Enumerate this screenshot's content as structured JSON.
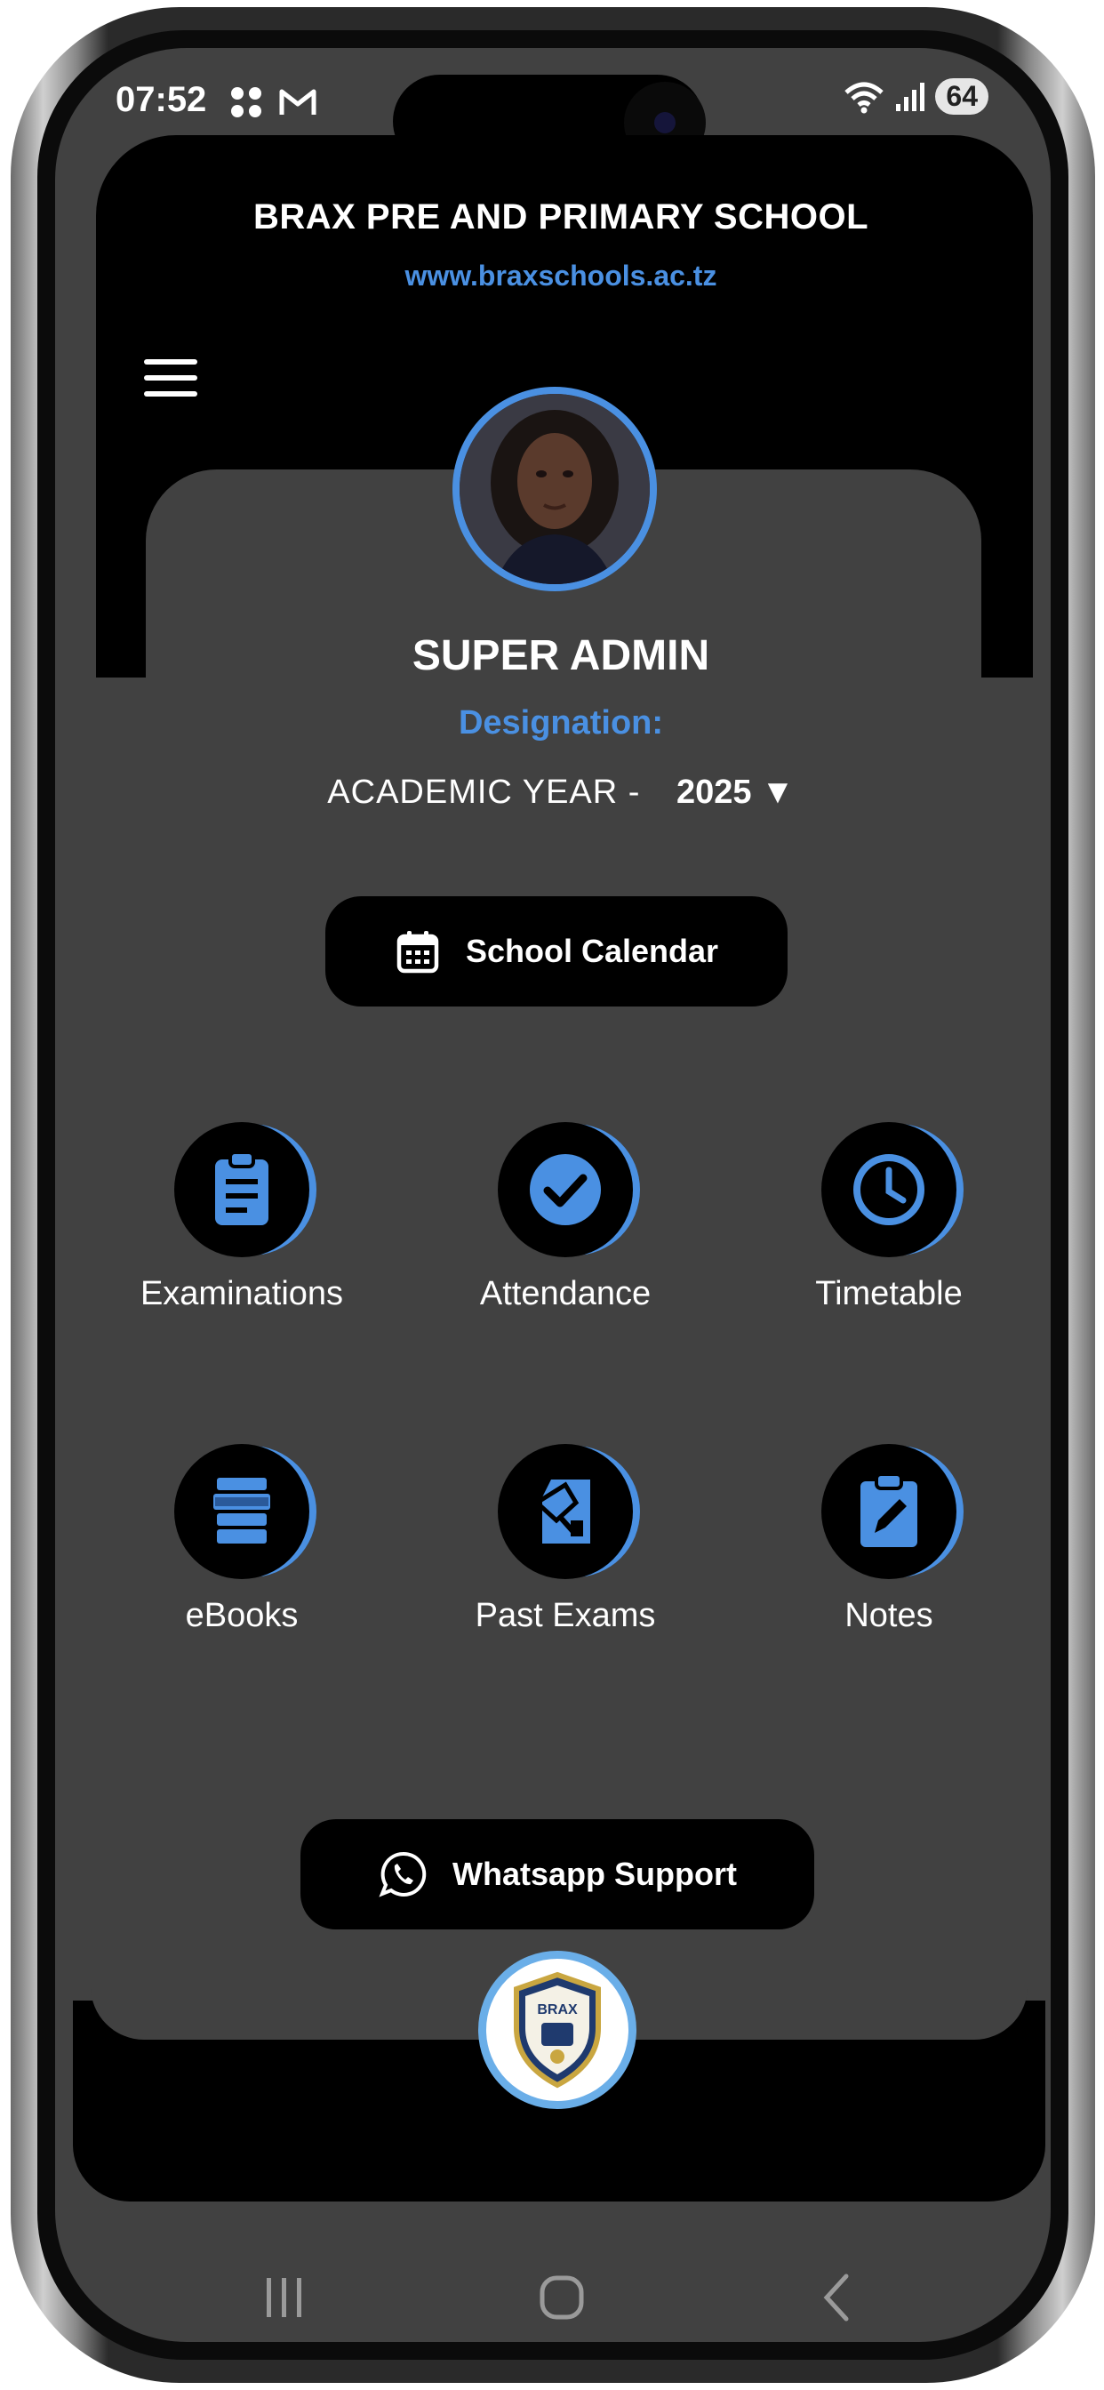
{
  "status_bar": {
    "time": "07:52",
    "left_icons": [
      "apps-grid-icon",
      "gmail-icon"
    ],
    "right_icons": [
      "wifi-icon",
      "signal-icon"
    ],
    "battery": "64"
  },
  "header": {
    "school_name": "BRAX PRE AND PRIMARY SCHOOL",
    "website": "www.braxschools.ac.tz"
  },
  "profile": {
    "name": "SUPER ADMIN",
    "designation": "Designation:",
    "academic_year_label": "ACADEMIC YEAR -",
    "academic_year_value": "2025 ▼"
  },
  "buttons": {
    "calendar": "School Calendar",
    "whatsapp": "Whatsapp Support"
  },
  "tiles": [
    {
      "label": "Examinations",
      "icon": "clipboard-icon"
    },
    {
      "label": "Attendance",
      "icon": "check-circle-icon"
    },
    {
      "label": "Timetable",
      "icon": "clock-icon"
    },
    {
      "label": "eBooks",
      "icon": "ebook-icon"
    },
    {
      "label": "Past Exams",
      "icon": "past-exam-icon"
    },
    {
      "label": "Notes",
      "icon": "notes-icon"
    }
  ],
  "logo_text": "BRAX",
  "colors": {
    "accent": "#4a90e2",
    "background": "#414141",
    "header": "#000000",
    "text": "#ffffff"
  }
}
